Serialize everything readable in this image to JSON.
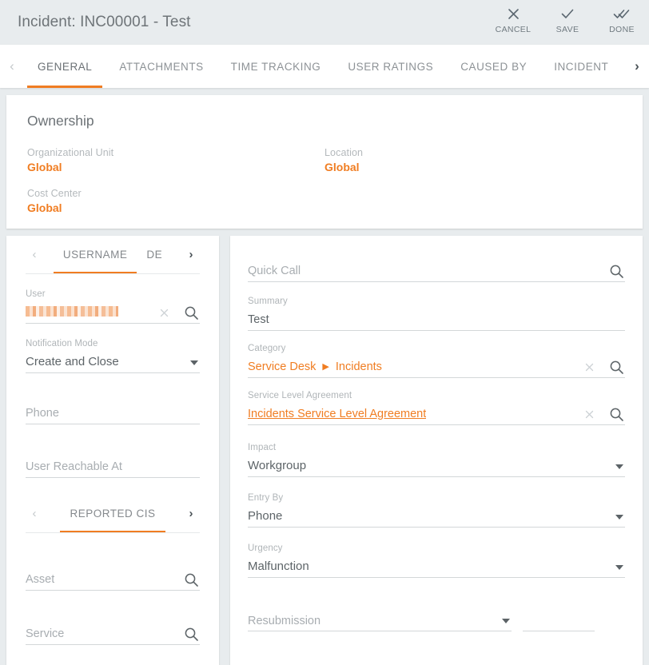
{
  "header": {
    "title": "Incident: INC00001 - Test",
    "actions": [
      {
        "label": "CANCEL",
        "icon": "close-icon"
      },
      {
        "label": "SAVE",
        "icon": "check-icon"
      },
      {
        "label": "DONE",
        "icon": "double-check-icon"
      }
    ]
  },
  "tabbar": {
    "prev_arrow": "‹",
    "next_arrow": "›",
    "tabs": [
      {
        "label": "GENERAL",
        "active": true
      },
      {
        "label": "ATTACHMENTS",
        "active": false
      },
      {
        "label": "TIME TRACKING",
        "active": false
      },
      {
        "label": "USER RATINGS",
        "active": false
      },
      {
        "label": "CAUSED BY",
        "active": false
      },
      {
        "label": "INCIDENT",
        "active": false
      }
    ]
  },
  "ownership": {
    "title": "Ownership",
    "fields": [
      {
        "label": "Organizational Unit",
        "value": "Global"
      },
      {
        "label": "Location",
        "value": "Global"
      },
      {
        "label": "Cost Center",
        "value": "Global"
      }
    ]
  },
  "left_panel": {
    "tabs_user": {
      "prev_arrow": "‹",
      "next_arrow": "›",
      "items": [
        {
          "label": "USERNAME",
          "active": true
        },
        {
          "label": "DE",
          "active": false
        }
      ]
    },
    "user_field": {
      "label": "User",
      "value_redacted": true,
      "clear_icon": "close-small-icon",
      "search_icon": "search-icon"
    },
    "notification_mode": {
      "label": "Notification Mode",
      "value": "Create and Close"
    },
    "phone": {
      "label": "",
      "placeholder": "Phone"
    },
    "user_reachable_at": {
      "label": "",
      "placeholder": "User Reachable At"
    },
    "tabs_cis": {
      "prev_arrow": "‹",
      "next_arrow": "›",
      "items": [
        {
          "label": "REPORTED CIS",
          "active": true
        }
      ]
    },
    "asset": {
      "placeholder": "Asset",
      "search_icon": "search-icon"
    },
    "service": {
      "placeholder": "Service",
      "search_icon": "search-icon"
    }
  },
  "right_panel": {
    "quick_call": {
      "placeholder": "Quick Call",
      "search_icon": "search-icon"
    },
    "summary": {
      "label": "Summary",
      "value": "Test"
    },
    "category": {
      "label": "Category",
      "value_part1": "Service Desk",
      "separator": "▶",
      "value_part2": "Incidents",
      "clear_icon": "close-small-icon",
      "search_icon": "search-icon"
    },
    "sla": {
      "label": "Service Level Agreement",
      "value": "Incidents Service Level Agreement",
      "clear_icon": "close-small-icon",
      "search_icon": "search-icon"
    },
    "impact": {
      "label": "Impact",
      "value": "Workgroup"
    },
    "entry_by": {
      "label": "Entry By",
      "value": "Phone"
    },
    "urgency": {
      "label": "Urgency",
      "value": "Malfunction"
    },
    "resubmission": {
      "placeholder": "Resubmission",
      "side_value": ""
    }
  },
  "colors": {
    "accent": "#f07d22",
    "page_bg": "#e8ecee",
    "card_bg": "#ffffff",
    "label": "#b0b5b8",
    "value": "#5d6468"
  }
}
